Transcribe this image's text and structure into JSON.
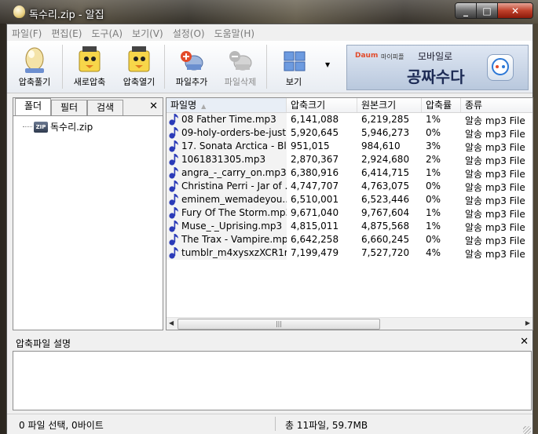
{
  "window": {
    "title": "독수리.zip - 알집",
    "min": "_",
    "max": "□",
    "close": "✕"
  },
  "menu": [
    "파일(F)",
    "편집(E)",
    "도구(A)",
    "보기(V)",
    "설정(O)",
    "도움말(H)"
  ],
  "toolbar": {
    "extract": "압축풀기",
    "new": "새로압축",
    "open": "압축열기",
    "add": "파일추가",
    "delete": "파일삭제",
    "view": "보기"
  },
  "banner": {
    "brand": "Daum",
    "brand_sub": "마이피플",
    "line1": "모바일로",
    "line2": "공짜수다"
  },
  "left_tabs": [
    "폴더",
    "필터",
    "검색"
  ],
  "tree": {
    "root": "독수리.zip",
    "zip_badge": "ZIP"
  },
  "columns": [
    "파일명",
    "압축크기",
    "원본크기",
    "압축률",
    "종류"
  ],
  "files": [
    {
      "name": "08 Father Time.mp3",
      "packed": "6,141,088",
      "size": "6,219,285",
      "ratio": "1%",
      "type": "알송 mp3 File"
    },
    {
      "name": "09-holy-orders-be-just...",
      "packed": "5,920,645",
      "size": "5,946,273",
      "ratio": "0%",
      "type": "알송 mp3 File"
    },
    {
      "name": "17. Sonata Arctica - Bl...",
      "packed": "951,015",
      "size": "984,610",
      "ratio": "3%",
      "type": "알송 mp3 File"
    },
    {
      "name": "1061831305.mp3",
      "packed": "2,870,367",
      "size": "2,924,680",
      "ratio": "2%",
      "type": "알송 mp3 File"
    },
    {
      "name": "angra_-_carry_on.mp3",
      "packed": "6,380,916",
      "size": "6,414,715",
      "ratio": "1%",
      "type": "알송 mp3 File"
    },
    {
      "name": "Christina Perri - Jar of ...",
      "packed": "4,747,707",
      "size": "4,763,075",
      "ratio": "0%",
      "type": "알송 mp3 File"
    },
    {
      "name": "eminem_wemadeyou....",
      "packed": "6,510,001",
      "size": "6,523,446",
      "ratio": "0%",
      "type": "알송 mp3 File"
    },
    {
      "name": "Fury Of The Storm.mp3",
      "packed": "9,671,040",
      "size": "9,767,604",
      "ratio": "1%",
      "type": "알송 mp3 File"
    },
    {
      "name": "Muse_-_Uprising.mp3",
      "packed": "4,815,011",
      "size": "4,875,568",
      "ratio": "1%",
      "type": "알송 mp3 File"
    },
    {
      "name": "The Trax - Vampire.mp3",
      "packed": "6,642,258",
      "size": "6,660,245",
      "ratio": "0%",
      "type": "알송 mp3 File"
    },
    {
      "name": "tumblr_m4xysxzXCR1r...",
      "packed": "7,199,479",
      "size": "7,527,720",
      "ratio": "4%",
      "type": "알송 mp3 File"
    }
  ],
  "description": {
    "title": "압축파일 설명",
    "close": "✕"
  },
  "status": {
    "selection": "0 파일 선택,  0바이트",
    "total": "총 11파일,  59.7MB"
  },
  "colors": {
    "note_icon": "#2b3bb8",
    "menu_text": "#7a7a7a"
  }
}
